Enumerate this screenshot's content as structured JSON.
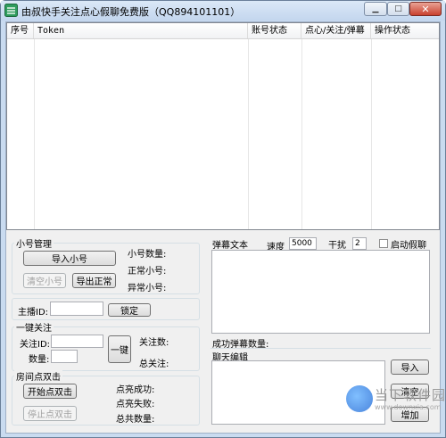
{
  "window": {
    "title": "由叔快手关注点心假聊免费版（QQ894101101）"
  },
  "list": {
    "columns": [
      "序号",
      "Token",
      "账号状态",
      "点心/关注/弹幕",
      "操作状态"
    ]
  },
  "account_group": {
    "title": "小号管理",
    "import_button": "导入小号",
    "clear_button": "清空小号",
    "export_button": "导出正常",
    "count_label": "小号数量:",
    "normal_label": "正常小号:",
    "abnormal_label": "异常小号:"
  },
  "anchor": {
    "id_label": "主播ID:",
    "id_value": "",
    "lock_button": "锁定"
  },
  "follow_group": {
    "title": "一键关注",
    "follow_id_label": "关注ID:",
    "follow_id_value": "",
    "quantity_label": "数量:",
    "quantity_value": "",
    "one_key_button": "一键",
    "follow_count_label": "关注数:",
    "total_follow_label": "总关注:"
  },
  "room_group": {
    "title": "房间点双击",
    "start_button": "开始点双击",
    "stop_button": "停止点双击",
    "success_label": "点亮成功:",
    "fail_label": "点亮失败:",
    "total_label": "总共数量:"
  },
  "danmu": {
    "title": "弹幕文本",
    "speed_label": "速度",
    "speed_value": "5000",
    "interfere_label": "干扰",
    "interfere_value": "2",
    "fake_chat_label": "启动假聊",
    "fake_chat_checked": false,
    "success_count_label": "成功弹幕数量:"
  },
  "chat_edit": {
    "title": "聊天编辑",
    "import_button": "导入",
    "clear_button": "清空",
    "add_button": "增加"
  },
  "watermark": {
    "text": "当下软件园",
    "sub": "www.downxia.com"
  },
  "colors": {
    "frame": "#c9dbf0",
    "client": "#f0f0f0",
    "accent": "#3c7fb1"
  }
}
